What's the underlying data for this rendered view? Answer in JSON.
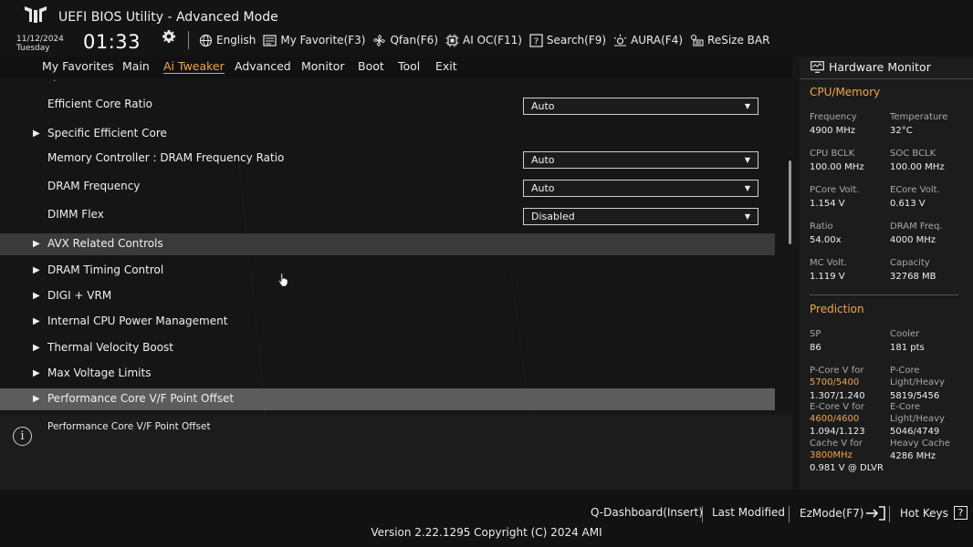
{
  "header": {
    "title": "UEFI BIOS Utility - Advanced Mode",
    "date": "11/12/2024",
    "weekday": "Tuesday",
    "time": "01:33",
    "toolbar": [
      {
        "icon": "globe-icon",
        "label": "English"
      },
      {
        "icon": "favorite-icon",
        "label": "My Favorite(F3)"
      },
      {
        "icon": "fan-icon",
        "label": "Qfan(F6)"
      },
      {
        "icon": "ai-chip-icon",
        "label": "AI OC(F11)"
      },
      {
        "icon": "search-icon",
        "label": "Search(F9)"
      },
      {
        "icon": "aura-icon",
        "label": "AURA(F4)"
      },
      {
        "icon": "resize-bar-icon",
        "label": "ReSize BAR"
      }
    ]
  },
  "nav": {
    "items": [
      "My Favorites",
      "Main",
      "Ai Tweaker",
      "Advanced",
      "Monitor",
      "Boot",
      "Tool",
      "Exit"
    ],
    "active": "Ai Tweaker"
  },
  "settings": [
    {
      "label": "Efficient Core Ratio",
      "value": "Auto",
      "submenu": false
    },
    {
      "label": "Specific Efficient Core",
      "value": "",
      "submenu": true
    },
    {
      "label": "Memory Controller : DRAM Frequency Ratio",
      "value": "Auto",
      "submenu": false
    },
    {
      "label": "DRAM Frequency",
      "value": "Auto",
      "submenu": false
    },
    {
      "label": "DIMM Flex",
      "value": "Disabled",
      "submenu": false
    },
    {
      "label": "AVX Related Controls",
      "value": "",
      "submenu": true
    },
    {
      "label": "DRAM Timing Control",
      "value": "",
      "submenu": true
    },
    {
      "label": "DIGI + VRM",
      "value": "",
      "submenu": true
    },
    {
      "label": "Internal CPU Power Management",
      "value": "",
      "submenu": true
    },
    {
      "label": "Thermal Velocity Boost",
      "value": "",
      "submenu": true
    },
    {
      "label": "Max Voltage Limits",
      "value": "",
      "submenu": true
    },
    {
      "label": "Performance Core V/F Point Offset",
      "value": "",
      "submenu": true
    }
  ],
  "help": {
    "text": "Performance Core V/F Point Offset"
  },
  "hardware_monitor": {
    "title": "Hardware Monitor",
    "cpu_section": "CPU/Memory",
    "cpu": [
      {
        "label": "Frequency",
        "value": "4900 MHz"
      },
      {
        "label": "Temperature",
        "value": "32°C"
      },
      {
        "label": "CPU BCLK",
        "value": "100.00 MHz"
      },
      {
        "label": "SOC BCLK",
        "value": "100.00 MHz"
      },
      {
        "label": "PCore Volt.",
        "value": "1.154 V"
      },
      {
        "label": "ECore Volt.",
        "value": "0.613 V"
      },
      {
        "label": "Ratio",
        "value": "54.00x"
      },
      {
        "label": "DRAM Freq.",
        "value": "4000 MHz"
      },
      {
        "label": "MC Volt.",
        "value": "1.119 V"
      },
      {
        "label": "Capacity",
        "value": "32768 MB"
      }
    ],
    "prediction_section": "Prediction",
    "prediction": {
      "sp_label": "SP",
      "sp_value": "86",
      "cooler_label": "Cooler",
      "cooler_value": "181 pts",
      "pcore_v_label": "P-Core V for",
      "pcore_v_freq": "5700/5400",
      "pcore_v_value": "1.307/1.240",
      "pcore_lh_label1": "P-Core",
      "pcore_lh_label2": "Light/Heavy",
      "pcore_lh_value": "5819/5456",
      "ecore_v_label": "E-Core V for",
      "ecore_v_freq": "4600/4600",
      "ecore_v_value": "1.094/1.123",
      "ecore_lh_label1": "E-Core",
      "ecore_lh_label2": "Light/Heavy",
      "ecore_lh_value": "5046/4749",
      "cache_v_label": "Cache V for",
      "cache_v_freq": "3800MHz",
      "cache_v_value": "0.981 V @ DLVR",
      "heavy_cache_label": "Heavy Cache",
      "heavy_cache_value": "4286 MHz"
    }
  },
  "footer": {
    "qdashboard": "Q-Dashboard(Insert)",
    "last_modified": "Last Modified",
    "ezmode": "EzMode(F7)",
    "hotkeys": "Hot Keys",
    "hotkeys_key": "?",
    "copyright": "Version 2.22.1295 Copyright (C) 2024 AMI"
  }
}
